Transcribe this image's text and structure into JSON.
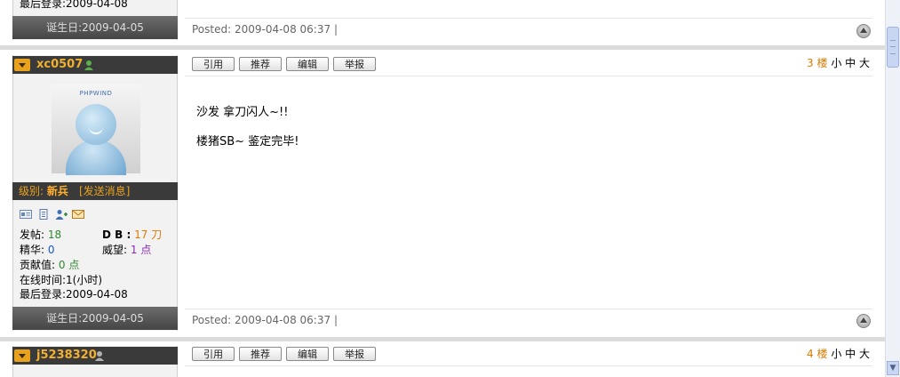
{
  "prev_post": {
    "last_login": "最后登录:2009-04-08",
    "birthday": "诞生日:2009-04-05",
    "posted": "Posted: 2009-04-08 06:37",
    "sep": "|"
  },
  "post": {
    "username": "xc0507",
    "avatar_brand": "PHPWIND",
    "level_label": "级别:",
    "rank": "新兵",
    "send_message": "[发送消息]",
    "icons": [
      "profile-card-icon",
      "document-icon",
      "add-friend-icon",
      "mail-icon"
    ],
    "stats": {
      "posts_label": "发帖:",
      "posts_value": "18",
      "db_label": "D B :",
      "db_value": "17 刀",
      "elite_label": "精华:",
      "elite_value": "0",
      "prestige_label": "威望:",
      "prestige_value": "1 点",
      "contribution_label": "贡献值:",
      "contribution_value": "0 点",
      "online_time": "在线时间:1(小时)",
      "last_login": "最后登录:2009-04-08"
    },
    "birthday": "诞生日:2009-04-05",
    "actions": [
      "引用",
      "推荐",
      "编辑",
      "举报"
    ],
    "floor_number": "3",
    "floor_label": "楼",
    "font_sizes": [
      "小",
      "中",
      "大"
    ],
    "content_lines": [
      "沙发  拿刀闪人~!!",
      "楼猪SB~ 鉴定完毕!"
    ],
    "posted": "Posted: 2009-04-08 06:37",
    "sep": "|"
  },
  "next_post": {
    "username": "j5238320",
    "actions": [
      "引用",
      "推荐",
      "编辑",
      "举报"
    ],
    "floor_number": "4",
    "floor_label": "楼",
    "font_sizes": [
      "小",
      "中",
      "大"
    ]
  },
  "colors": {
    "accent_orange": "#e07a00",
    "bar_dark": "#3a3a3a",
    "username": "#f0b030"
  }
}
